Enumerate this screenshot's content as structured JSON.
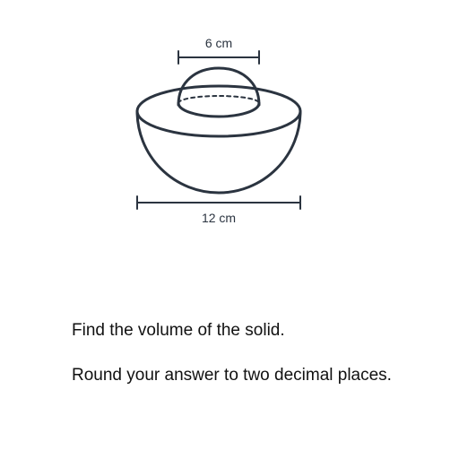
{
  "figure": {
    "small_diameter_label": "6 cm",
    "large_diameter_label": "12 cm",
    "stroke_color": "#2b3440"
  },
  "question": {
    "line1": "Find the volume of the solid.",
    "line2": "Round your answer to two decimal places."
  }
}
